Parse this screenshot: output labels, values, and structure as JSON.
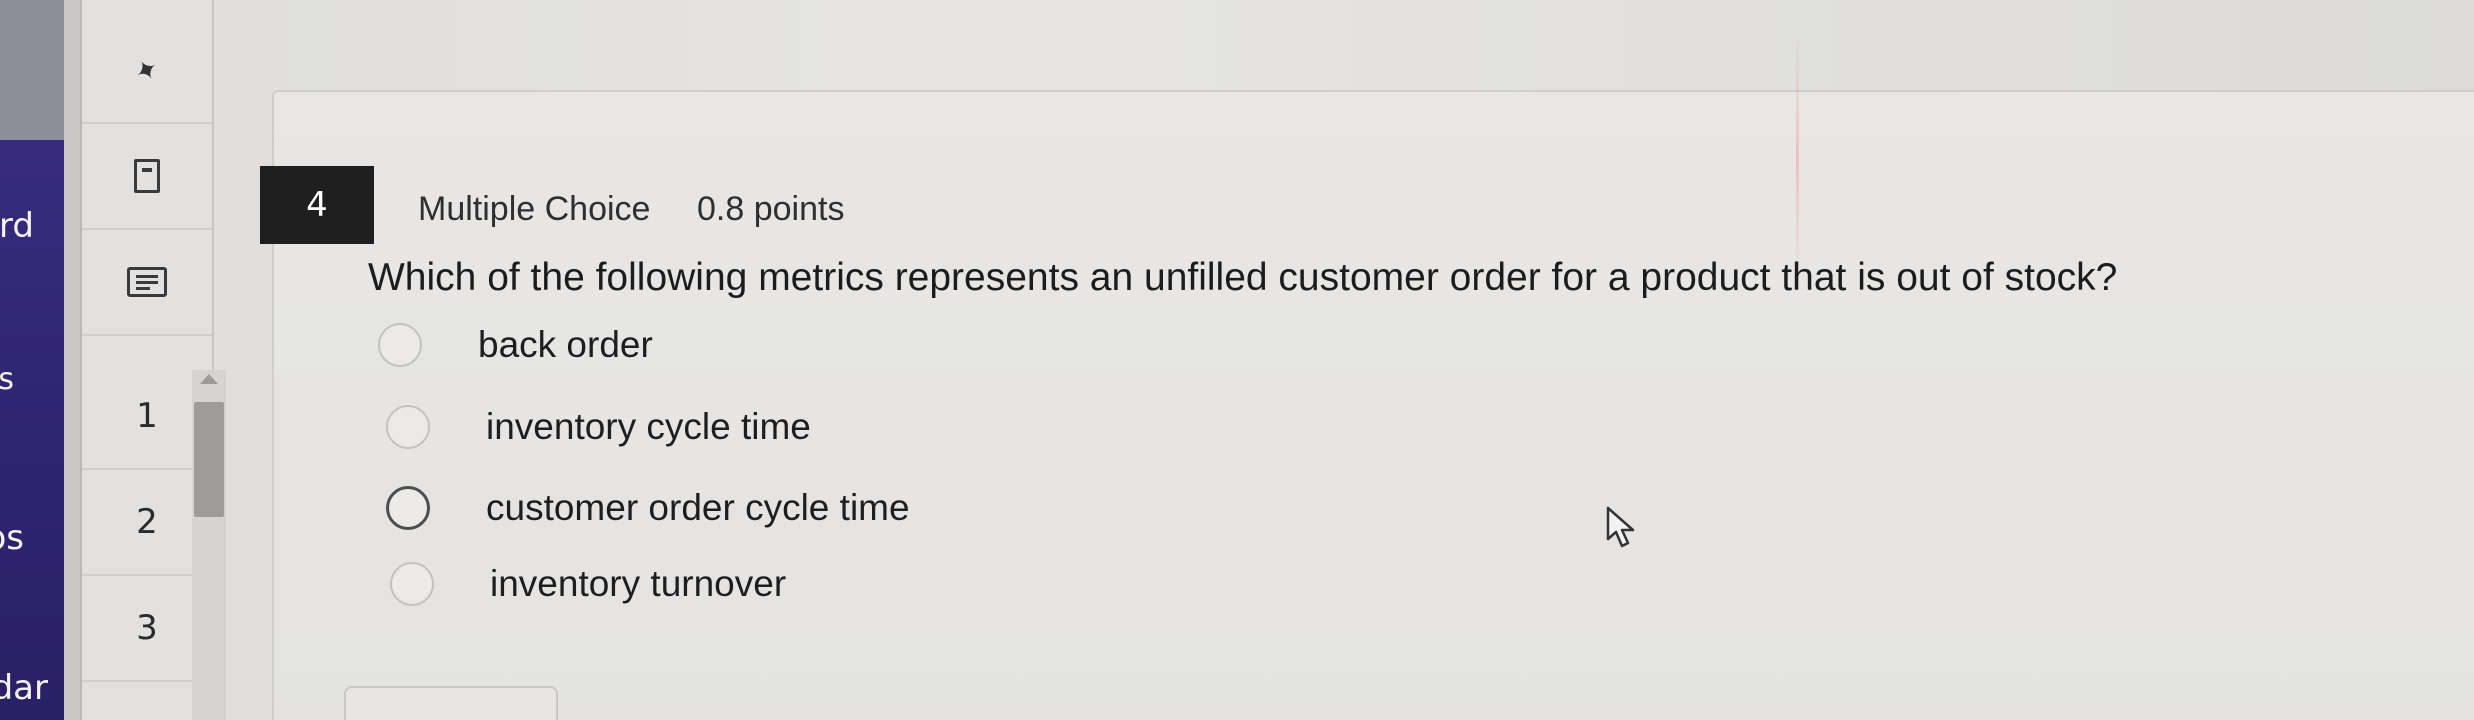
{
  "leftnav": {
    "items": [
      "rd",
      "es",
      "os",
      "dar"
    ]
  },
  "rail": {
    "pin_icon": "pin-icon",
    "bookmark_icon": "bookmark-icon",
    "notes_icon": "notes-icon",
    "questions": [
      "1",
      "2",
      "3"
    ]
  },
  "question": {
    "number": "4",
    "type": "Multiple Choice",
    "points": "0.8 points",
    "text": "Which of the following metrics represents an unfilled customer order for a product that is out of stock?",
    "options": [
      {
        "label": "back order"
      },
      {
        "label": "inventory cycle time"
      },
      {
        "label": "customer order cycle time"
      },
      {
        "label": "inventory turnover"
      }
    ]
  },
  "colors": {
    "nav_purple": "#2f2470",
    "question_badge": "#1f1f20"
  }
}
